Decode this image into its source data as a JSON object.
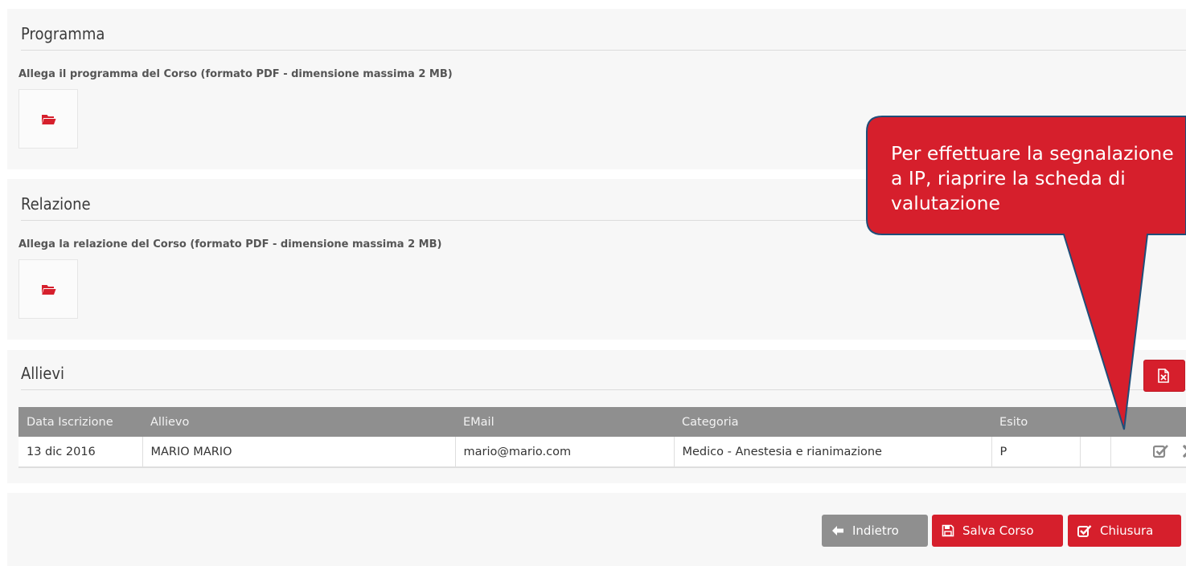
{
  "programma": {
    "title": "Programma",
    "caption": "Allega il programma del Corso (formato PDF - dimensione massima 2 MB)"
  },
  "relazione": {
    "title": "Relazione",
    "caption": "Allega la relazione del Corso (formato PDF - dimensione massima 2 MB)"
  },
  "allievi": {
    "title": "Allievi",
    "columns": [
      "Data Iscrizione",
      "Allievo",
      "EMail",
      "Categoria",
      "Esito",
      ""
    ],
    "rows": [
      {
        "data": "13 dic 2016",
        "allievo": "MARIO MARIO",
        "email": "mario@mario.com",
        "categoria": "Medico - Anestesia e rianimazione",
        "esito": "P"
      }
    ]
  },
  "actions": {
    "back": "Indietro",
    "save": "Salva Corso",
    "close": "Chiusura"
  },
  "callout": {
    "text": "Per effettuare la segnalazione a IP, riaprire la scheda di valutazione"
  },
  "icons": {
    "folder": "folder-open-icon",
    "excel": "file-excel-icon",
    "check": "check-square-icon",
    "remove": "times-icon",
    "back": "arrow-left-icon",
    "save": "floppy-disk-icon"
  },
  "colors": {
    "accent": "#d61f2c",
    "header_gray": "#8f8f8f",
    "panel_bg": "#f7f7f7"
  }
}
